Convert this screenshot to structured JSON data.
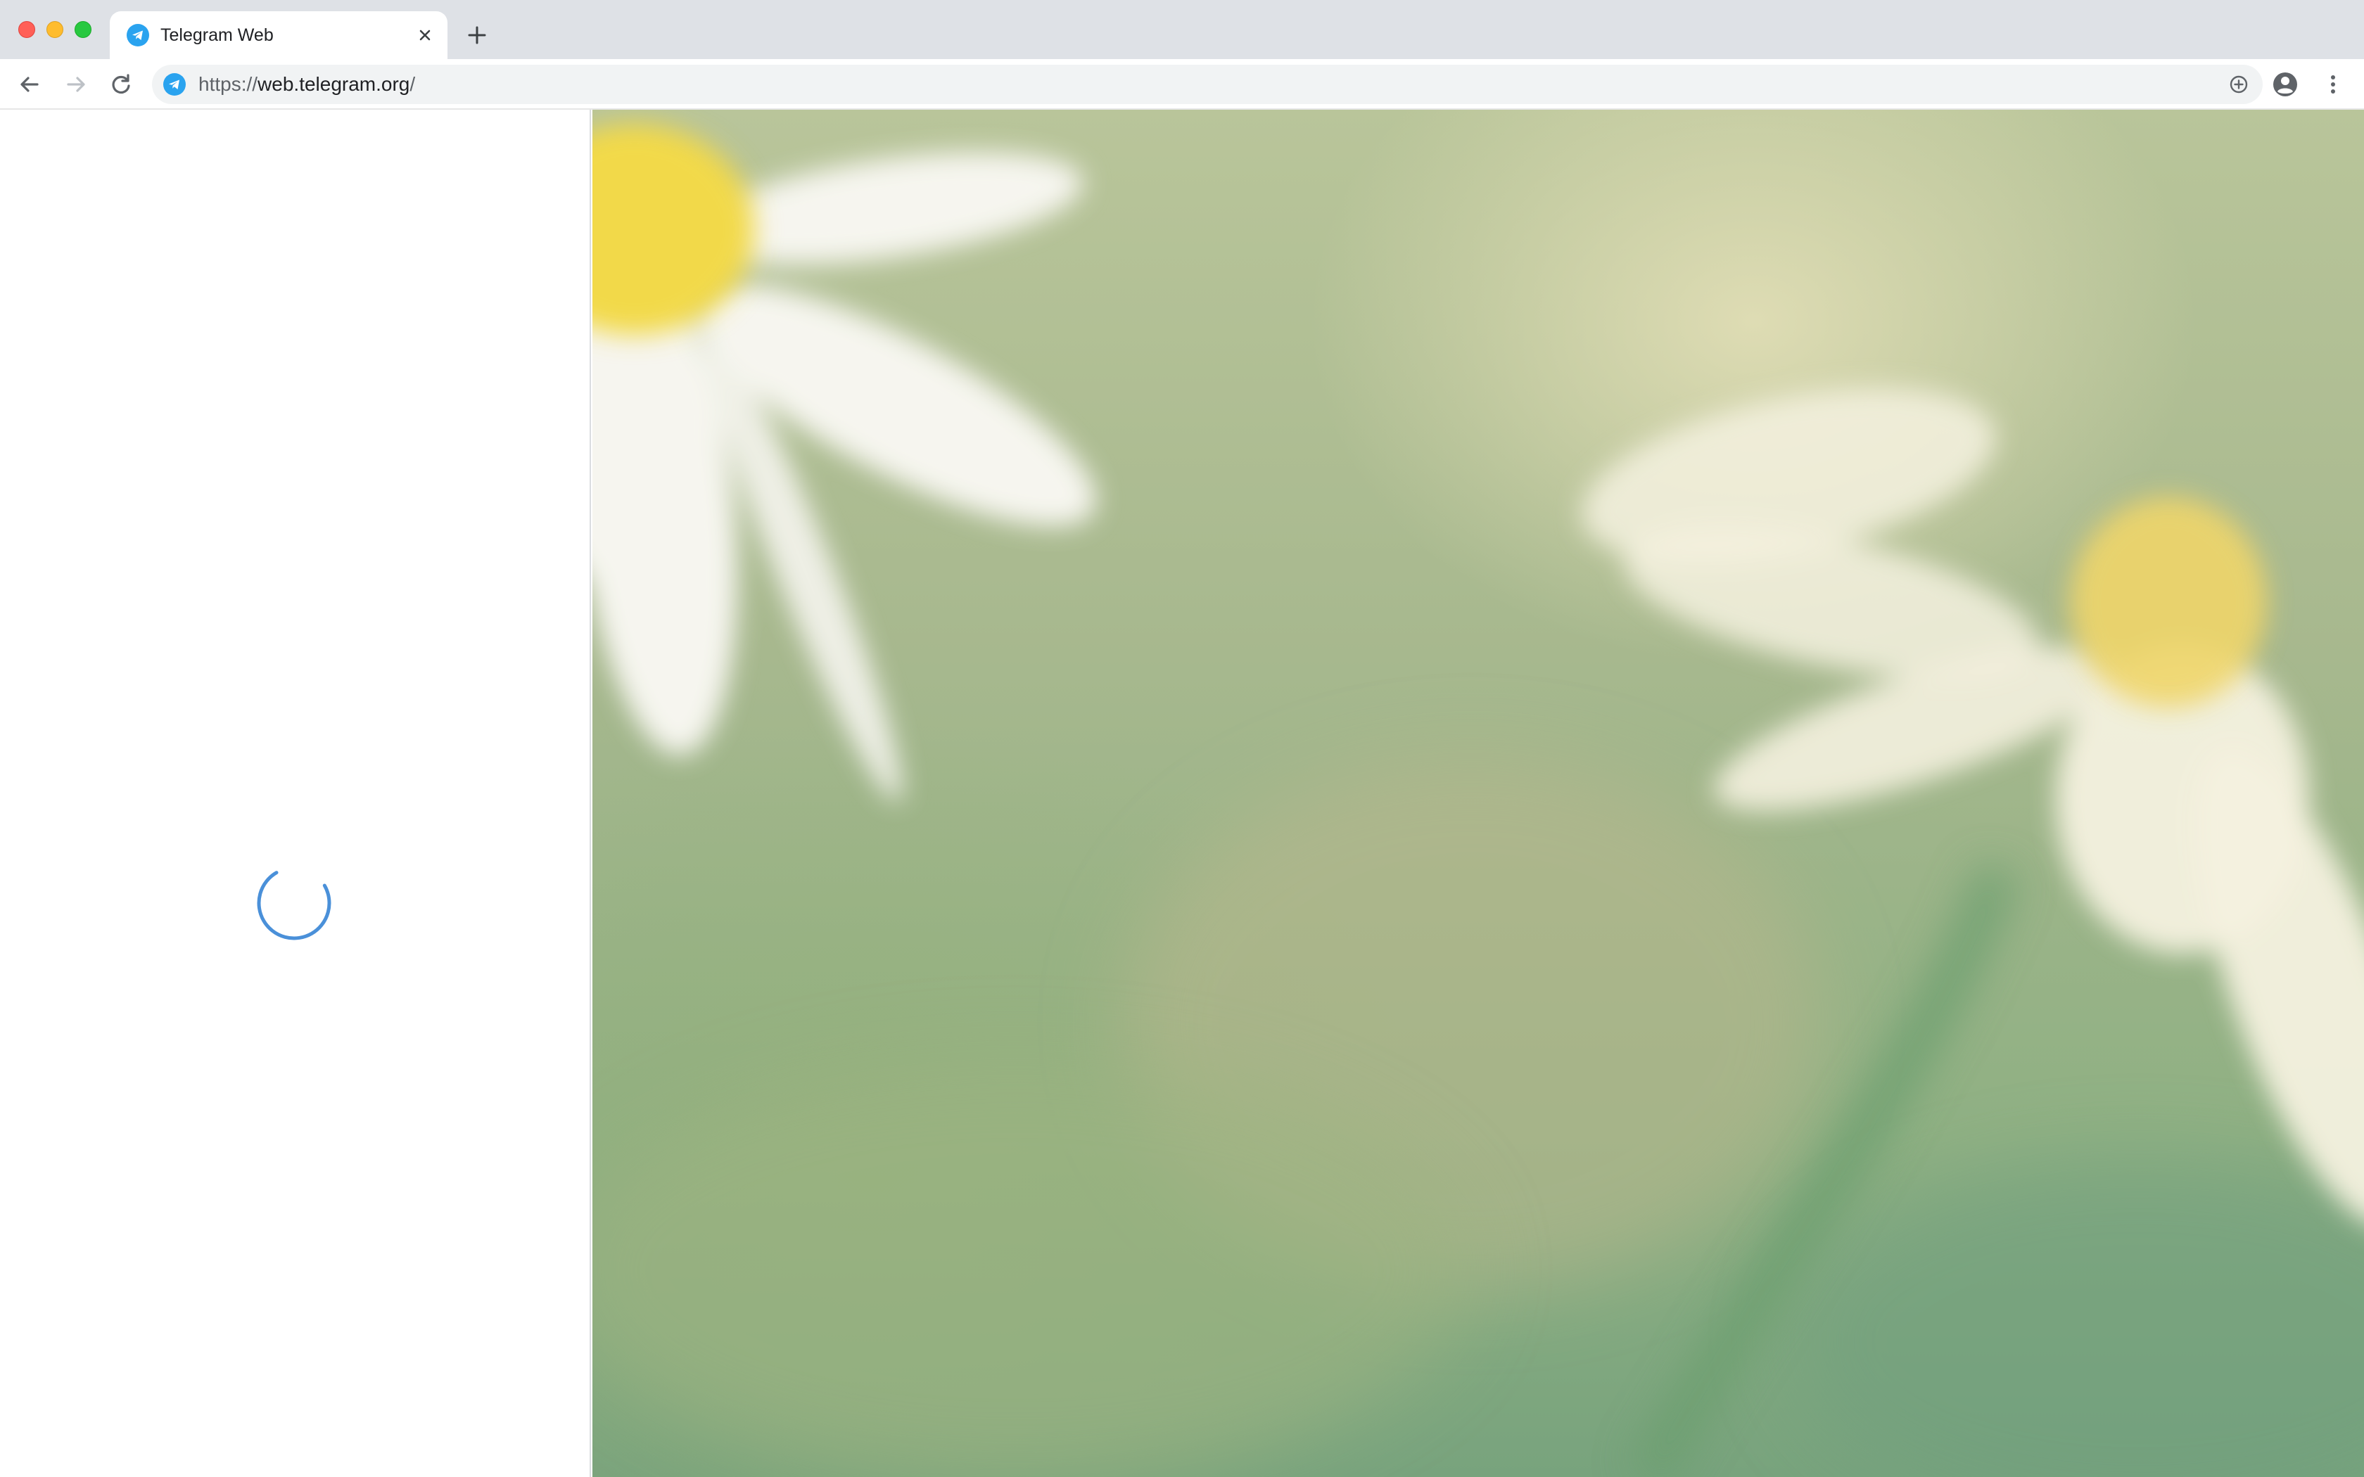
{
  "browser": {
    "tab": {
      "title": "Telegram Web",
      "favicon": "telegram-icon",
      "close_icon": "close-icon"
    },
    "new_tab_icon": "plus-icon",
    "toolbar": {
      "back_icon": "arrow-left-icon",
      "forward_icon": "arrow-right-icon",
      "reload_icon": "reload-icon",
      "profile_icon": "account-circle-icon",
      "menu_icon": "more-vert-icon"
    },
    "omnibox": {
      "scheme": "https://",
      "host": "web.telegram.org",
      "path": "/",
      "site_icon": "telegram-icon",
      "install_icon": "add-circle-icon"
    }
  },
  "page": {
    "loading_indicator": "spinner-icon",
    "background": "blurred-daisy-flowers"
  },
  "colors": {
    "telegram_blue": "#2aa3ef",
    "spinner_blue": "#4a90d9",
    "tabstrip_bg": "#dee1e6",
    "omnibox_bg": "#f1f3f4"
  }
}
